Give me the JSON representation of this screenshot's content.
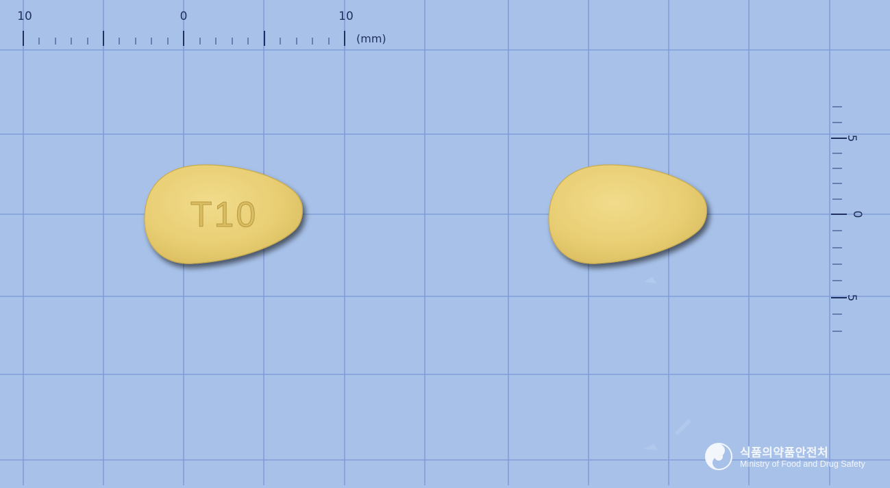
{
  "scale_top": {
    "labels": [
      "10",
      "0",
      "10"
    ],
    "unit": "(mm)"
  },
  "scale_right": {
    "labels": [
      "5",
      "0",
      "5"
    ]
  },
  "tablets": [
    {
      "view": "front",
      "imprint": "T10",
      "color": "#e9cf73"
    },
    {
      "view": "back",
      "imprint": "",
      "color": "#ecd479"
    }
  ],
  "watermark": {
    "org_korean": "식품의약품안전처",
    "org_english": "Ministry of Food and Drug Safety"
  },
  "colors": {
    "background": "#a7c1e9",
    "grid": "#7c99d6",
    "scale": "#1f2f5e",
    "tablet": "#e9cf73"
  }
}
